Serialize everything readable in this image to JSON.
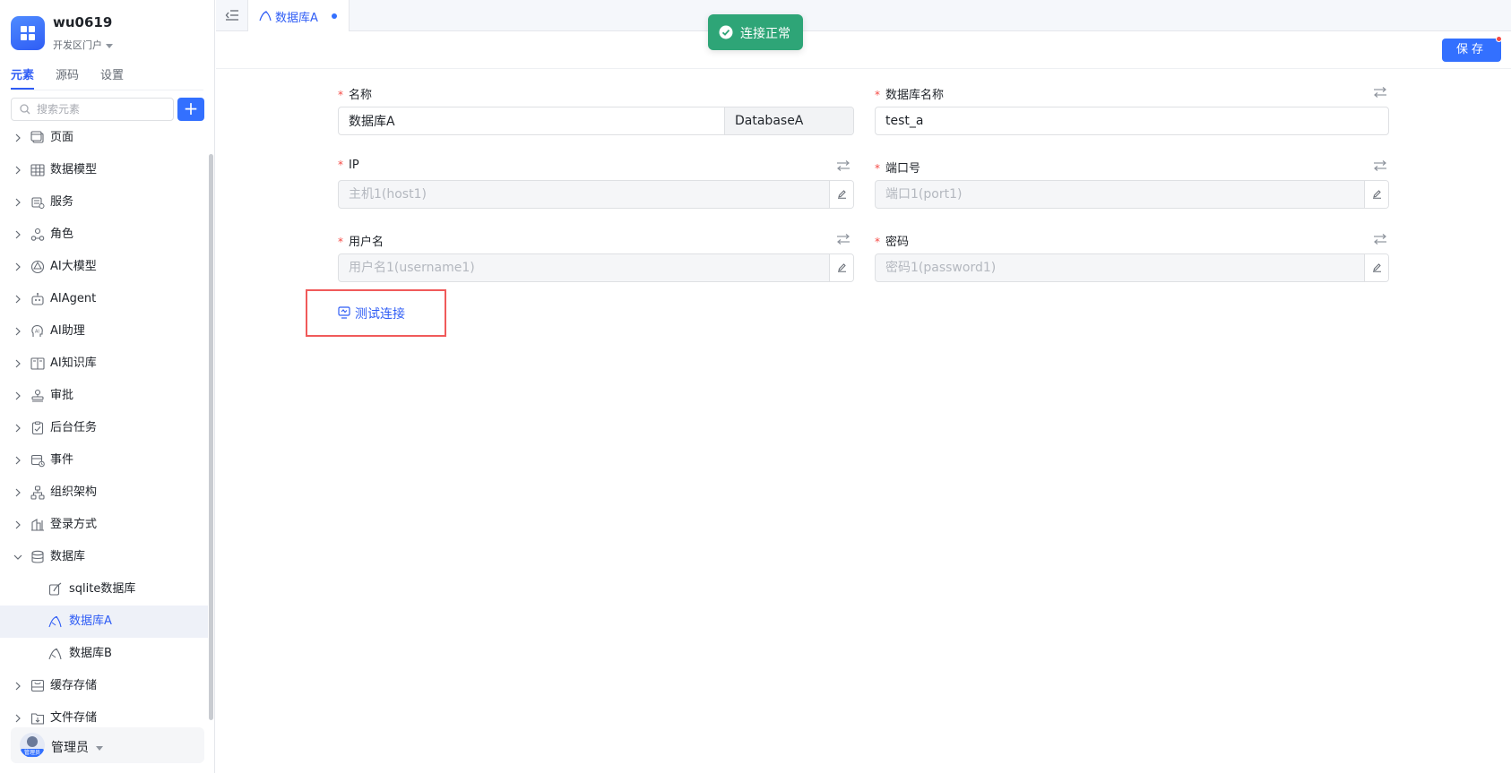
{
  "app": {
    "name": "wu0619",
    "portal": "开发区门户"
  },
  "sidebar": {
    "tabs": [
      "元素",
      "源码",
      "设置"
    ],
    "active_tab": "元素",
    "search_placeholder": "搜索元素",
    "add_label": "+",
    "items": [
      {
        "label": "页面",
        "icon": "page-icon",
        "expanded": false
      },
      {
        "label": "数据模型",
        "icon": "table-icon",
        "expanded": false
      },
      {
        "label": "服务",
        "icon": "service-icon",
        "expanded": false
      },
      {
        "label": "角色",
        "icon": "role-icon",
        "expanded": false
      },
      {
        "label": "AI大模型",
        "icon": "ai-model-icon",
        "expanded": false
      },
      {
        "label": "AIAgent",
        "icon": "robot-icon",
        "expanded": false
      },
      {
        "label": "AI助理",
        "icon": "ai-assistant-icon",
        "expanded": false
      },
      {
        "label": "AI知识库",
        "icon": "book-icon",
        "expanded": false
      },
      {
        "label": "审批",
        "icon": "stamp-icon",
        "expanded": false
      },
      {
        "label": "后台任务",
        "icon": "task-icon",
        "expanded": false
      },
      {
        "label": "事件",
        "icon": "event-icon",
        "expanded": false
      },
      {
        "label": "组织架构",
        "icon": "org-icon",
        "expanded": false
      },
      {
        "label": "登录方式",
        "icon": "login-icon",
        "expanded": false
      },
      {
        "label": "数据库",
        "icon": "database-icon",
        "expanded": true
      },
      {
        "label": "sqlite数据库",
        "icon": "sqlite-icon",
        "child": true
      },
      {
        "label": "数据库A",
        "icon": "mysql-icon",
        "child": true,
        "selected": true
      },
      {
        "label": "数据库B",
        "icon": "mysql-icon",
        "child": true
      },
      {
        "label": "缓存存储",
        "icon": "cache-icon",
        "expanded": false
      },
      {
        "label": "文件存储",
        "icon": "file-storage-icon",
        "expanded": false
      }
    ],
    "user": {
      "name": "管理员",
      "avatar_tag": "管理员"
    }
  },
  "tabs": {
    "active": {
      "label": "数据库A",
      "unsaved": true
    }
  },
  "toolbar": {
    "save_label": "保存"
  },
  "toast": {
    "text": "连接正常",
    "type": "success"
  },
  "form": {
    "name": {
      "label": "名称",
      "value": "数据库A",
      "alias": "DatabaseA",
      "required": true
    },
    "db_name": {
      "label": "数据库名称",
      "value": "test_a",
      "required": true
    },
    "ip": {
      "label": "IP",
      "placeholder": "主机1(host1)",
      "required": true
    },
    "port": {
      "label": "端口号",
      "placeholder": "端口1(port1)",
      "required": true
    },
    "username": {
      "label": "用户名",
      "placeholder": "用户名1(username1)",
      "required": true
    },
    "password": {
      "label": "密码",
      "placeholder": "密码1(password1)",
      "required": true
    },
    "test_connection_label": "测试连接"
  },
  "colors": {
    "accent": "#3370ff",
    "success": "#2ea577",
    "required": "#f54a45",
    "highlight_box": "#f05a5a"
  }
}
